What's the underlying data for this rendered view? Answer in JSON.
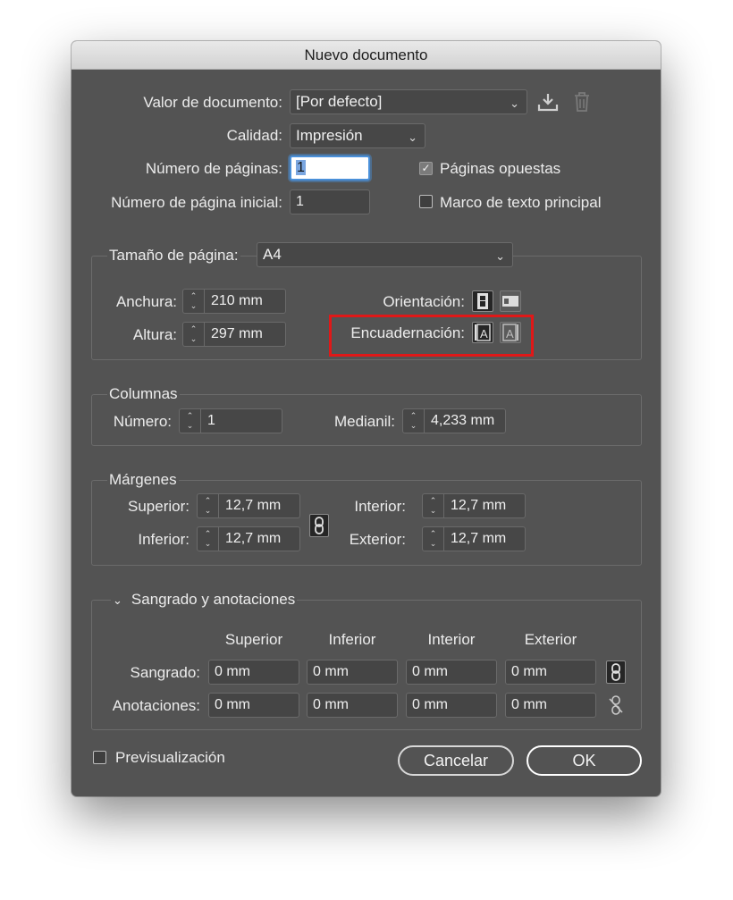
{
  "window": {
    "title": "Nuevo documento"
  },
  "document_preset": {
    "label": "Valor de documento:",
    "value": "[Por defecto]",
    "save_icon": "save-preset-icon",
    "delete_icon": "trash-icon"
  },
  "quality": {
    "label": "Calidad:",
    "value": "Impresión"
  },
  "pages": {
    "count_label": "Número de páginas:",
    "count_value": "1",
    "start_label": "Número de página inicial:",
    "start_value": "1",
    "facing_label": "Páginas opuestas",
    "facing_checked": true,
    "primary_frame_label": "Marco de texto principal",
    "primary_frame_checked": false
  },
  "page_size": {
    "label": "Tamaño de página:",
    "value": "A4",
    "width_label": "Anchura:",
    "width_value": "210 mm",
    "height_label": "Altura:",
    "height_value": "297 mm",
    "orientation_label": "Orientación:",
    "binding_label": "Encuadernación:"
  },
  "columns": {
    "title": "Columnas",
    "number_label": "Número:",
    "number_value": "1",
    "gutter_label": "Medianil:",
    "gutter_value": "4,233 mm"
  },
  "margins": {
    "title": "Márgenes",
    "top_label": "Superior:",
    "top_value": "12,7 mm",
    "bottom_label": "Inferior:",
    "bottom_value": "12,7 mm",
    "inside_label": "Interior:",
    "inside_value": "12,7 mm",
    "outside_label": "Exterior:",
    "outside_value": "12,7 mm"
  },
  "bleed_slug": {
    "title": "Sangrado y anotaciones",
    "col_top": "Superior",
    "col_bottom": "Inferior",
    "col_inside": "Interior",
    "col_outside": "Exterior",
    "bleed_label": "Sangrado:",
    "bleed": [
      "0 mm",
      "0 mm",
      "0 mm",
      "0 mm"
    ],
    "slug_label": "Anotaciones:",
    "slug": [
      "0 mm",
      "0 mm",
      "0 mm",
      "0 mm"
    ]
  },
  "footer": {
    "preview_label": "Previsualización",
    "cancel_label": "Cancelar",
    "ok_label": "OK"
  },
  "colors": {
    "dialog_bg": "#535353",
    "field_bg": "#454545",
    "highlight": "#e01818",
    "focus": "#4a90d9"
  }
}
